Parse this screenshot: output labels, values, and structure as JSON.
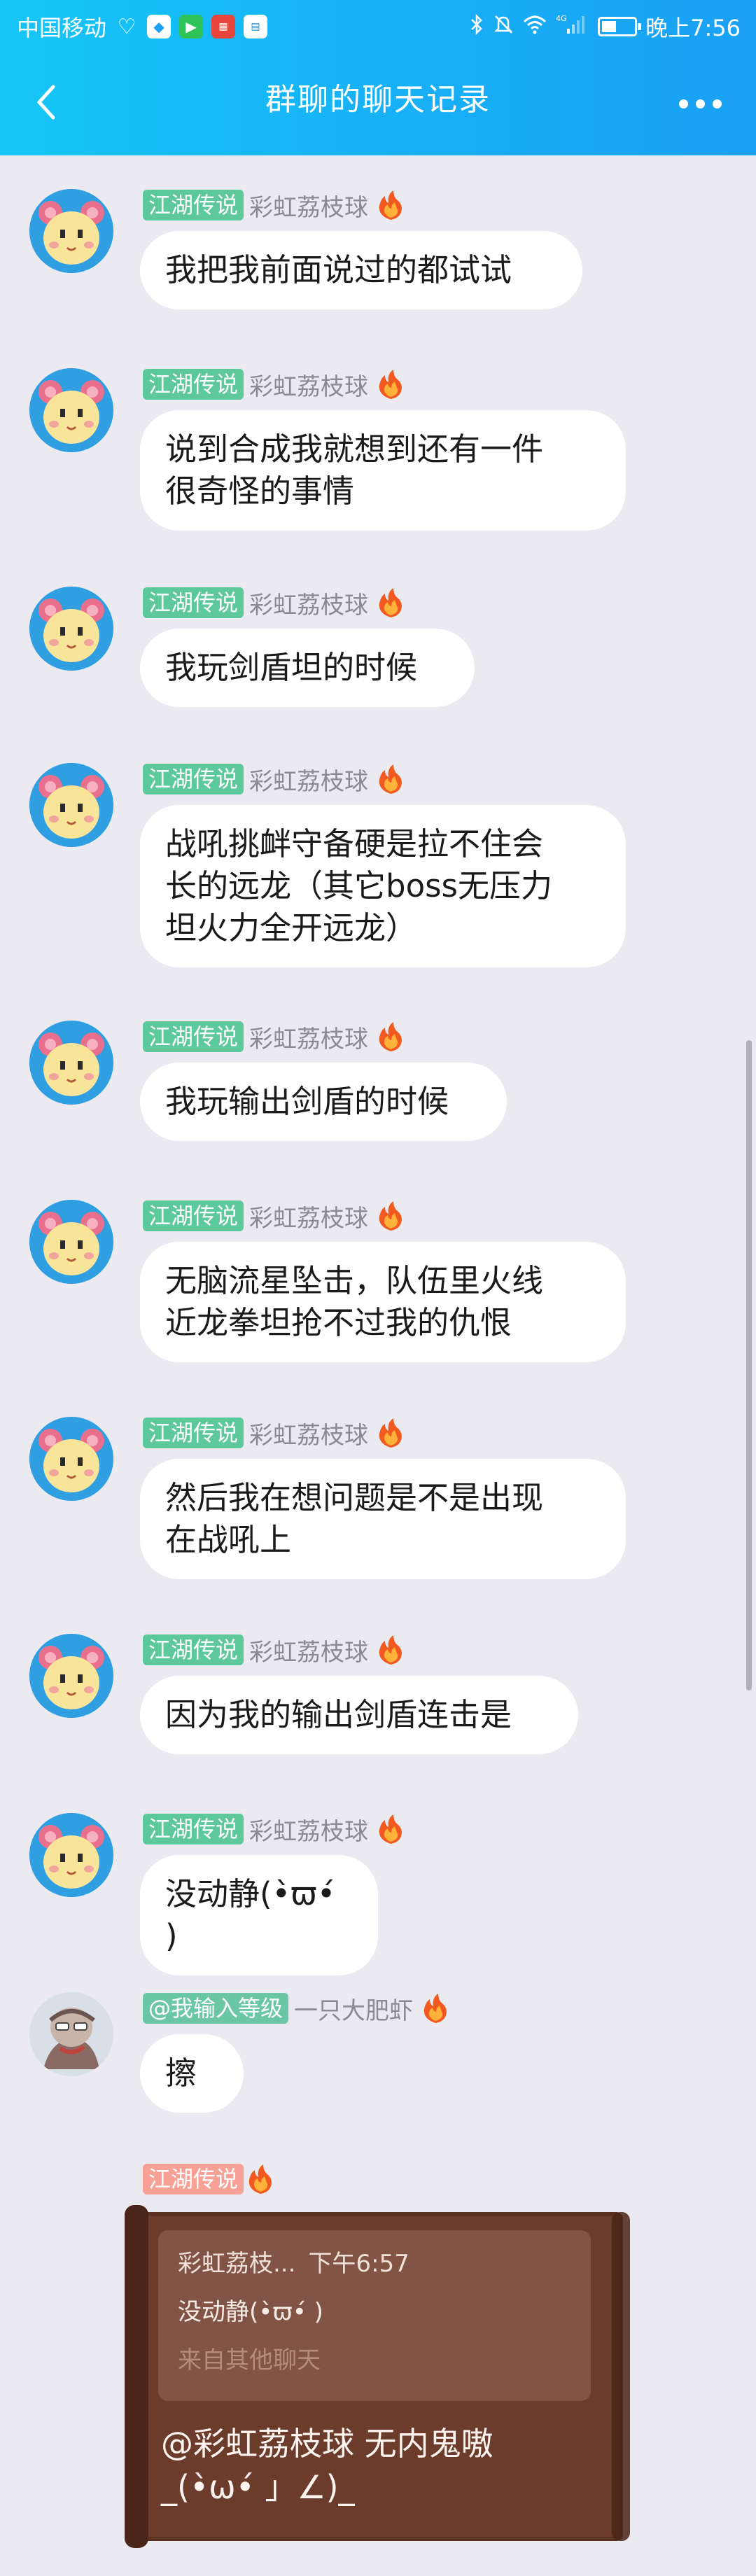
{
  "status_bar": {
    "carrier": "中国移动",
    "time": "晚上7:56",
    "signal_label": "4G",
    "battery_level": 0.45,
    "notification_icons": [
      "heart-pulse-icon",
      "shield-icon",
      "play-store-icon",
      "news-app-icon",
      "browser-app-icon"
    ]
  },
  "header": {
    "title": "群聊的聊天记录",
    "back_icon": "chevron-left-icon",
    "more_icon": "more-dots-icon"
  },
  "colors": {
    "header_gradient_start": "#16c6f6",
    "header_gradient_end": "#1aa0f4",
    "background": "#eaeaf0",
    "badge_green": "#5dc99a",
    "badge_pink": "#f7a095",
    "quote_brown": "#6b3c2c"
  },
  "messages": [
    {
      "title": "江湖传说",
      "sender": "彩虹荔枝球",
      "text": "我把我前面说过的都试试"
    },
    {
      "title": "江湖传说",
      "sender": "彩虹荔枝球",
      "text": "说到合成我就想到还有一件\n很奇怪的事情"
    },
    {
      "title": "江湖传说",
      "sender": "彩虹荔枝球",
      "text": "我玩剑盾坦的时候"
    },
    {
      "title": "江湖传说",
      "sender": "彩虹荔枝球",
      "text": "战吼挑衅守备硬是拉不住会\n长的远龙（其它boss无压力\n坦火力全开远龙）"
    },
    {
      "title": "江湖传说",
      "sender": "彩虹荔枝球",
      "text": "我玩输出剑盾的时候"
    },
    {
      "title": "江湖传说",
      "sender": "彩虹荔枝球",
      "text": "无脑流星坠击，队伍里火线\n近龙拳坦抢不过我的仇恨"
    },
    {
      "title": "江湖传说",
      "sender": "彩虹荔枝球",
      "text": "然后我在想问题是不是出现\n在战吼上"
    },
    {
      "title": "江湖传说",
      "sender": "彩虹荔枝球",
      "text": "因为我的输出剑盾连击是"
    },
    {
      "title": "江湖传说",
      "sender": "彩虹荔枝球",
      "text": "没动静(•̀ϖ•́ )"
    },
    {
      "title": "@我输入等级",
      "sender": "一只大肥虾",
      "text": "擦"
    }
  ],
  "last_message": {
    "title": "江湖传说",
    "quote": {
      "sender": "彩虹荔枝...",
      "time": "下午6:57",
      "text": "没动静(•̀ϖ•́ )",
      "source": "来自其他聊天"
    },
    "reply": "@彩虹荔枝球 无内鬼嗷\n_(•̀ω•́ 」∠)_"
  },
  "scrollbar": {
    "visible_fraction": 0.27,
    "position_fraction": 0.5
  }
}
